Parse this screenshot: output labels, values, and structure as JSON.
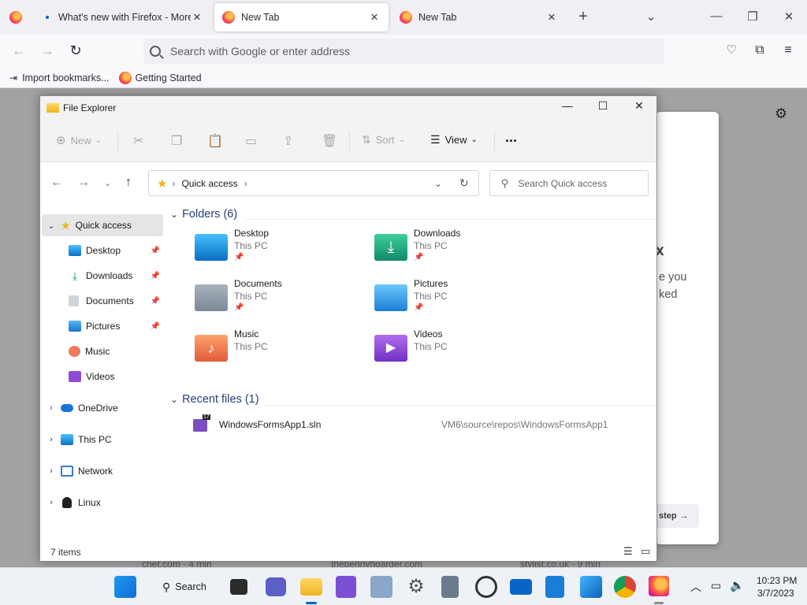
{
  "firefox": {
    "tabs": [
      {
        "title": "What's new with Firefox - More"
      },
      {
        "title": "New Tab"
      },
      {
        "title": "New Tab"
      }
    ],
    "url_placeholder": "Search with Google or enter address",
    "bookmarks": [
      {
        "label": "Import bookmarks..."
      },
      {
        "label": "Getting Started"
      }
    ],
    "ntp": {
      "card_fragments": [
        "x",
        "e you",
        "ked",
        "step"
      ],
      "stories": [
        "cnet.com · 4 min",
        "thepennyhoarder.com",
        "stylist.co.uk · 9 min"
      ]
    }
  },
  "explorer": {
    "title": "File Explorer",
    "toolbar": {
      "new": "New",
      "sort": "Sort",
      "view": "View",
      "more": "..."
    },
    "address": {
      "location": "Quick access"
    },
    "search_placeholder": "Search Quick access",
    "sidebar": {
      "quick_access": "Quick access",
      "items": [
        {
          "label": "Desktop"
        },
        {
          "label": "Downloads"
        },
        {
          "label": "Documents"
        },
        {
          "label": "Pictures"
        },
        {
          "label": "Music"
        },
        {
          "label": "Videos"
        }
      ],
      "roots": [
        {
          "label": "OneDrive"
        },
        {
          "label": "This PC"
        },
        {
          "label": "Network"
        },
        {
          "label": "Linux"
        }
      ]
    },
    "folders_header": "Folders (6)",
    "folders": [
      {
        "name": "Desktop",
        "location": "This PC"
      },
      {
        "name": "Downloads",
        "location": "This PC"
      },
      {
        "name": "Documents",
        "location": "This PC"
      },
      {
        "name": "Pictures",
        "location": "This PC"
      },
      {
        "name": "Music",
        "location": "This PC"
      },
      {
        "name": "Videos",
        "location": "This PC"
      }
    ],
    "recent_header": "Recent files (1)",
    "recent_files": [
      {
        "name": "WindowsFormsApp1.sln",
        "path": "VM6\\source\\repos\\WindowsFormsApp1",
        "badge": "17"
      }
    ],
    "status": "7 items"
  },
  "taskbar": {
    "search_label": "Search",
    "time": "10:23 PM",
    "date": "3/7/2023"
  }
}
